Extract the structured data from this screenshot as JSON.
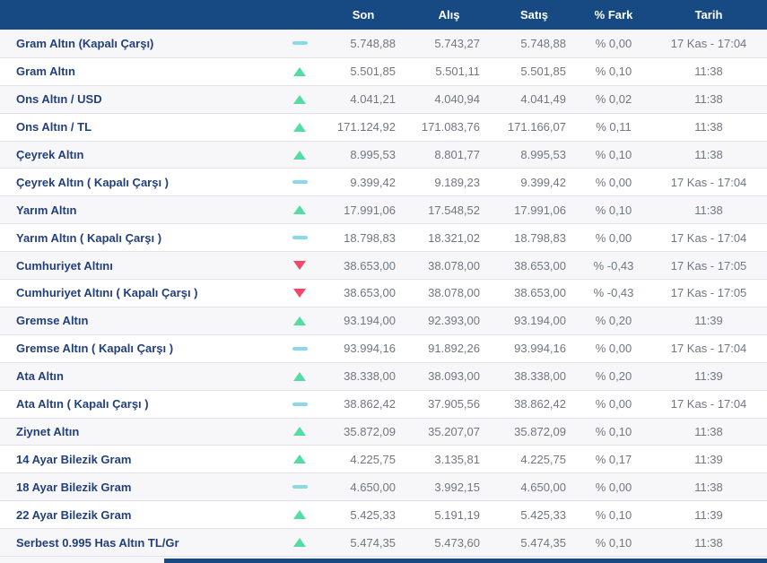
{
  "table": {
    "columns": {
      "son": "Son",
      "alis": "Alış",
      "satis": "Satış",
      "fark": "% Fark",
      "tarih": "Tarih"
    },
    "rows": [
      {
        "name": "Gram Altın (Kapalı Çarşı)",
        "trend": "flat",
        "son": "5.748,88",
        "alis": "5.743,27",
        "satis": "5.748,88",
        "fark": "% 0,00",
        "tarih": "17 Kas - 17:04"
      },
      {
        "name": "Gram Altın",
        "trend": "up",
        "son": "5.501,85",
        "alis": "5.501,11",
        "satis": "5.501,85",
        "fark": "% 0,10",
        "tarih": "11:38"
      },
      {
        "name": "Ons Altın / USD",
        "trend": "up",
        "son": "4.041,21",
        "alis": "4.040,94",
        "satis": "4.041,49",
        "fark": "% 0,02",
        "tarih": "11:38"
      },
      {
        "name": "Ons Altın / TL",
        "trend": "up",
        "son": "171.124,92",
        "alis": "171.083,76",
        "satis": "171.166,07",
        "fark": "% 0,11",
        "tarih": "11:38"
      },
      {
        "name": "Çeyrek Altın",
        "trend": "up",
        "son": "8.995,53",
        "alis": "8.801,77",
        "satis": "8.995,53",
        "fark": "% 0,10",
        "tarih": "11:38"
      },
      {
        "name": "Çeyrek Altın ( Kapalı Çarşı )",
        "trend": "flat",
        "son": "9.399,42",
        "alis": "9.189,23",
        "satis": "9.399,42",
        "fark": "% 0,00",
        "tarih": "17 Kas - 17:04"
      },
      {
        "name": "Yarım Altın",
        "trend": "up",
        "son": "17.991,06",
        "alis": "17.548,52",
        "satis": "17.991,06",
        "fark": "% 0,10",
        "tarih": "11:38"
      },
      {
        "name": "Yarım Altın ( Kapalı Çarşı )",
        "trend": "flat",
        "son": "18.798,83",
        "alis": "18.321,02",
        "satis": "18.798,83",
        "fark": "% 0,00",
        "tarih": "17 Kas - 17:04"
      },
      {
        "name": "Cumhuriyet Altını",
        "trend": "down",
        "son": "38.653,00",
        "alis": "38.078,00",
        "satis": "38.653,00",
        "fark": "% -0,43",
        "tarih": "17 Kas - 17:05"
      },
      {
        "name": "Cumhuriyet Altını ( Kapalı Çarşı )",
        "trend": "down",
        "son": "38.653,00",
        "alis": "38.078,00",
        "satis": "38.653,00",
        "fark": "% -0,43",
        "tarih": "17 Kas - 17:05"
      },
      {
        "name": "Gremse Altın",
        "trend": "up",
        "son": "93.194,00",
        "alis": "92.393,00",
        "satis": "93.194,00",
        "fark": "% 0,20",
        "tarih": "11:39"
      },
      {
        "name": "Gremse Altın ( Kapalı Çarşı )",
        "trend": "flat",
        "son": "93.994,16",
        "alis": "91.892,26",
        "satis": "93.994,16",
        "fark": "% 0,00",
        "tarih": "17 Kas - 17:04"
      },
      {
        "name": "Ata Altın",
        "trend": "up",
        "son": "38.338,00",
        "alis": "38.093,00",
        "satis": "38.338,00",
        "fark": "% 0,20",
        "tarih": "11:39"
      },
      {
        "name": "Ata Altın ( Kapalı Çarşı )",
        "trend": "flat",
        "son": "38.862,42",
        "alis": "37.905,56",
        "satis": "38.862,42",
        "fark": "% 0,00",
        "tarih": "17 Kas - 17:04"
      },
      {
        "name": "Ziynet Altın",
        "trend": "up",
        "son": "35.872,09",
        "alis": "35.207,07",
        "satis": "35.872,09",
        "fark": "% 0,10",
        "tarih": "11:38"
      },
      {
        "name": "14 Ayar Bilezik Gram",
        "trend": "up",
        "son": "4.225,75",
        "alis": "3.135,81",
        "satis": "4.225,75",
        "fark": "% 0,17",
        "tarih": "11:39"
      },
      {
        "name": "18 Ayar Bilezik Gram",
        "trend": "flat",
        "son": "4.650,00",
        "alis": "3.992,15",
        "satis": "4.650,00",
        "fark": "% 0,00",
        "tarih": "11:38"
      },
      {
        "name": "22 Ayar Bilezik Gram",
        "trend": "up",
        "son": "5.425,33",
        "alis": "5.191,19",
        "satis": "5.425,33",
        "fark": "% 0,10",
        "tarih": "11:39"
      },
      {
        "name": "Serbest 0.995 Has Altın TL/Gr",
        "trend": "up",
        "son": "5.474,35",
        "alis": "5.473,60",
        "satis": "5.474,35",
        "fark": "% 0,10",
        "tarih": "11:38"
      }
    ]
  },
  "colors": {
    "header_bg": "#174a83",
    "row_alt_bg": "#f7f7f9",
    "row_border": "#e2e2ea",
    "label_text": "#22407c",
    "value_text": "#6f7781",
    "trend_up": "#55dba4",
    "trend_down": "#f4476c",
    "trend_flat": "#8bd9e6"
  }
}
